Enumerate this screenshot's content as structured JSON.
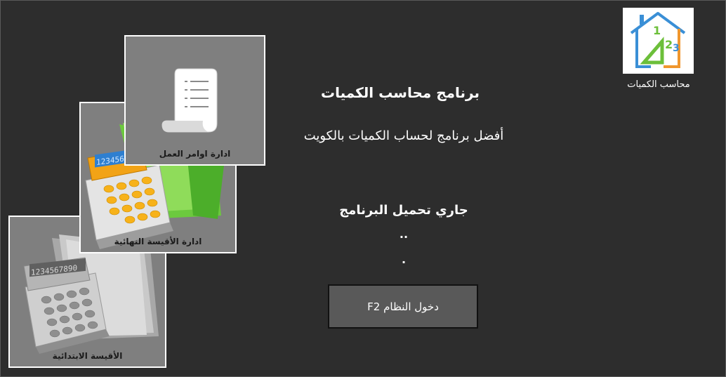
{
  "logo": {
    "caption": "محاسب الكميات",
    "digits": [
      "1",
      "2",
      "3"
    ]
  },
  "header": {
    "title": "برنامج محاسب الكميات",
    "subtitle": "أفضل برنامج لحساب الكميات بالكويت"
  },
  "status": {
    "loading": "جاري تحميل البرنامج",
    "dots1": "..",
    "dots2": "."
  },
  "actions": {
    "enter_label": "دخول النظام F2"
  },
  "cards": {
    "orders": {
      "label": "ادارة اوامر العمل"
    },
    "final": {
      "label": "ادارة الأقيسة النهائية",
      "display": "123456"
    },
    "initial": {
      "label": "الأقيسة الابتدائية",
      "display": "1234567890"
    }
  },
  "colors": {
    "background": "#2d2d2d",
    "card": "#7f7f7f",
    "button": "#595959",
    "logo_blue": "#3a8fd6",
    "logo_green": "#6cbf3a",
    "logo_orange": "#f0962d"
  }
}
